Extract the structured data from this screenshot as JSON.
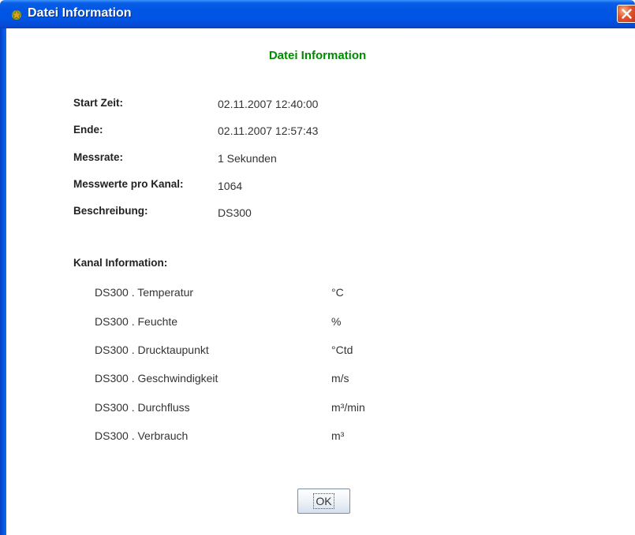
{
  "window": {
    "title": "Datei Information",
    "close_icon": "close-icon",
    "app_icon": "app-icon"
  },
  "content": {
    "heading": "Datei Information",
    "fields": [
      {
        "label": "Start Zeit:",
        "value": "02.11.2007 12:40:00"
      },
      {
        "label": "Ende:",
        "value": "02.11.2007 12:57:43"
      },
      {
        "label": "Messrate:",
        "value": "1 Sekunden"
      },
      {
        "label": "Messwerte pro Kanal:",
        "value": "1064"
      },
      {
        "label": "Beschreibung:",
        "value": "DS300"
      }
    ],
    "channel_heading": "Kanal Information:",
    "channels": [
      {
        "name": "DS300 . Temperatur",
        "unit": "°C"
      },
      {
        "name": "DS300 . Feuchte",
        "unit": "%"
      },
      {
        "name": "DS300 . Drucktaupunkt",
        "unit": "°Ctd"
      },
      {
        "name": "DS300 . Geschwindigkeit",
        "unit": "m/s"
      },
      {
        "name": "DS300 . Durchfluss",
        "unit": "m³/min"
      },
      {
        "name": "DS300 . Verbrauch",
        "unit": "m³"
      }
    ]
  },
  "buttons": {
    "ok_label": "OK"
  },
  "colors": {
    "title_bar": "#0054e3",
    "heading": "#008a00",
    "close_button": "#e5542a"
  }
}
